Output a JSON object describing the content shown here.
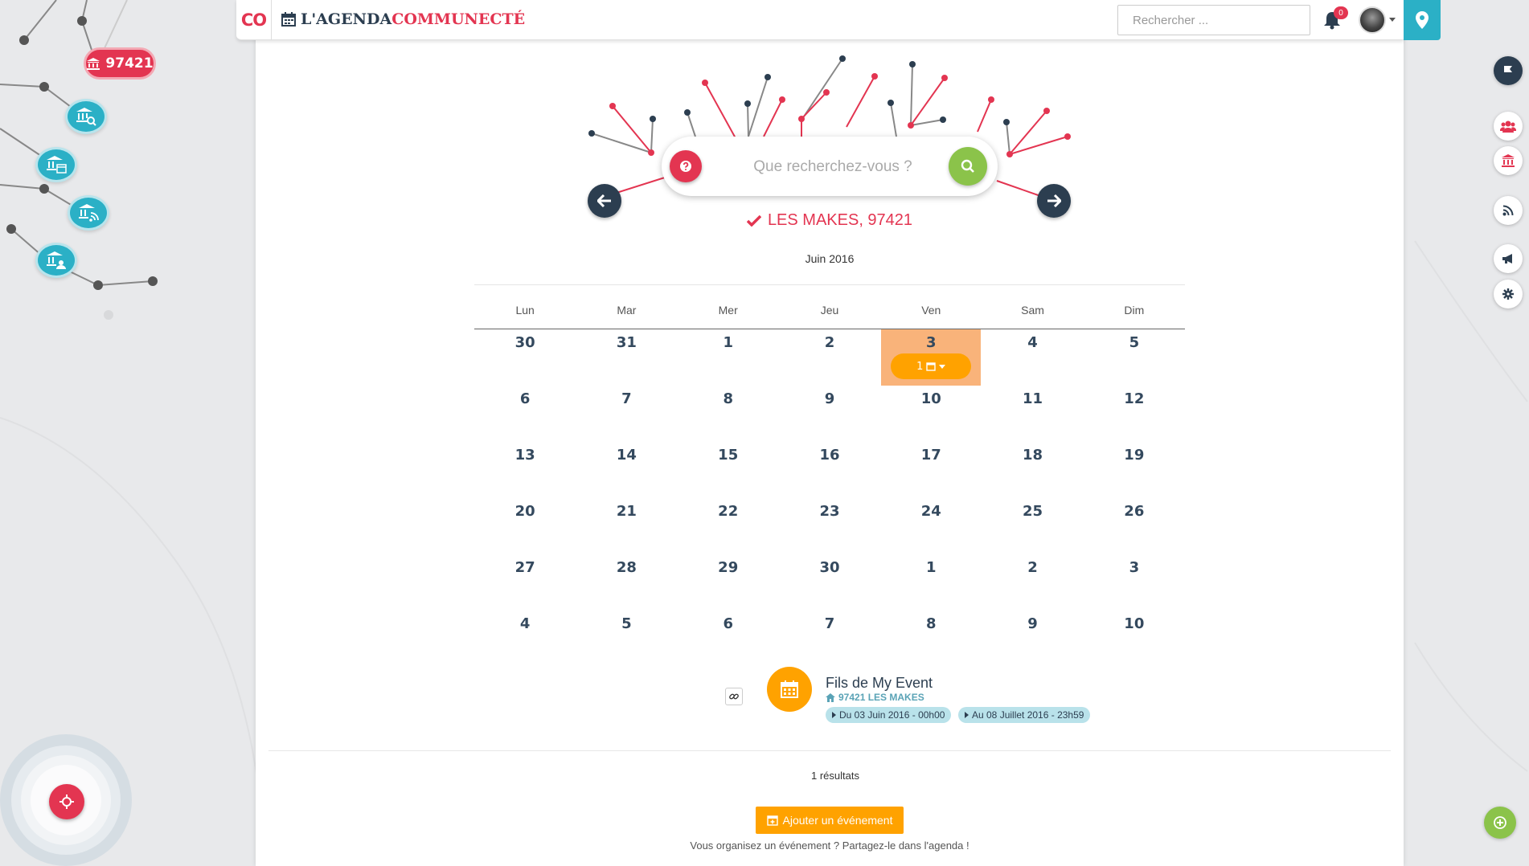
{
  "header": {
    "logo_text": "CO",
    "app_title_part1": "L'AGENDA ",
    "app_title_part2": "COMMUNECTÉ",
    "search_placeholder": "Rechercher ...",
    "notifications_count": "0"
  },
  "scope": {
    "search_placeholder": "Que recherchez-vous ?",
    "location_label": "LES MAKES, 97421"
  },
  "left_panel": {
    "zip_badge": "97421"
  },
  "calendar": {
    "month_title": "Juin 2016",
    "weekdays": [
      "Lun",
      "Mar",
      "Mer",
      "Jeu",
      "Ven",
      "Sam",
      "Dim"
    ],
    "weeks": [
      [
        "30",
        "31",
        "1",
        "2",
        "3",
        "4",
        "5"
      ],
      [
        "6",
        "7",
        "8",
        "9",
        "10",
        "11",
        "12"
      ],
      [
        "13",
        "14",
        "15",
        "16",
        "17",
        "18",
        "19"
      ],
      [
        "20",
        "21",
        "22",
        "23",
        "24",
        "25",
        "26"
      ],
      [
        "27",
        "28",
        "29",
        "30",
        "1",
        "2",
        "3"
      ],
      [
        "4",
        "5",
        "6",
        "7",
        "8",
        "9",
        "10"
      ]
    ],
    "event_day": "3",
    "event_count": "1"
  },
  "results": {
    "items": [
      {
        "title": "Fils de My Event",
        "location": "97421 LES MAKES",
        "start": "Du 03 Juin 2016 - 00h00",
        "end": "Au 08 Juillet 2016 - 23h59"
      }
    ],
    "count_label": "1 résultats",
    "add_button": "Ajouter un événement",
    "add_hint": "Vous organisez un événement ? Partagez-le dans l'agenda !"
  },
  "colors": {
    "brand_red": "#e33551",
    "brand_blue": "#2bb0c6",
    "brand_dark": "#2c3e50",
    "event_orange": "#ffa200",
    "search_green": "#8bc34a"
  }
}
